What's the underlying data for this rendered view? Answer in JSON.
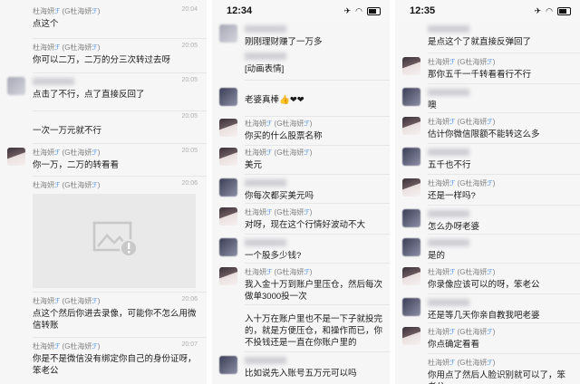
{
  "colors": {
    "panel_bg": "#f6f6f6",
    "nickname": "#808080",
    "timestamp": "#b0b0b0",
    "fish_icon": "#4a90e2"
  },
  "panel1": {
    "messages": [
      {
        "name": "杜海妍",
        "tag": "(G杜海妍",
        "time": "20:04",
        "text": "点这个"
      },
      {
        "name": "杜海妍",
        "tag": "(G杜海妍",
        "time": "20:05",
        "text": "你可以二万，二万的分三次转过去呀"
      },
      {
        "time": "20:05",
        "text": "点击了不行，点了直接反回了"
      },
      {
        "time": "20:05",
        "text": "一次一万元就不行"
      },
      {
        "name": "杜海妍",
        "tag": "(G杜海妍",
        "time": "20:05",
        "text": "你一万，二万的转看看"
      },
      {
        "name": "杜海妍",
        "tag": "(G杜海妍",
        "time": "20:06",
        "text": ""
      },
      {
        "name": "杜海妍",
        "tag": "(G杜海妍",
        "time": "20:06",
        "text": "点这个然后你进去录像，可能你不怎么用微信转账"
      },
      {
        "name": "杜海妍",
        "tag": "(G杜海妍",
        "time": "20:07",
        "text": "你是不是微信没有绑定你自己的身份证呀，笨老公"
      }
    ]
  },
  "panel2": {
    "status_time": "12:34",
    "messages": [
      {
        "text": "刚刚理财赚了一万多"
      },
      {
        "text": "[动画表情]"
      },
      {
        "text": "老婆真棒👍❤❤"
      },
      {
        "name": "杜海妍",
        "tag": "(G杜海妍",
        "text": "你买的什么股票名称"
      },
      {
        "name": "杜海妍",
        "tag": "(G杜海妍",
        "text": "美元"
      },
      {
        "text": "你每次都买美元吗"
      },
      {
        "name": "杜海妍",
        "tag": "(G杜海妍",
        "text": "对呀，现在这个行情好波动不大"
      },
      {
        "text": "一个股多少钱?"
      },
      {
        "name": "杜海妍",
        "tag": "(G杜海妍",
        "text": "我入金十万到账户里压仓，然后每次做单3000投一次"
      },
      {
        "text": "入十万在账户里也不是一下子就投完的，就是方便压仓，和操作而已，你不投钱还是一直在你账户里的"
      },
      {
        "text": "比如说先入账号五万元可以吗"
      }
    ]
  },
  "panel3": {
    "status_time": "12:35",
    "messages": [
      {
        "text": "是点这个了就直接反弹回了"
      },
      {
        "name": "杜海妍",
        "tag": "(G杜海妍",
        "text": "那你五千一千转看看行不行"
      },
      {
        "text": "噢"
      },
      {
        "name": "杜海妍",
        "tag": "(G杜海妍",
        "text": "估计你微信限额不能转这么多"
      },
      {
        "text": "五千也不行"
      },
      {
        "name": "杜海妍",
        "tag": "(G杜海妍",
        "text": "还是一样吗?"
      },
      {
        "text": "怎么办呀老婆"
      },
      {
        "text": "是的"
      },
      {
        "name": "杜海妍",
        "tag": "(G杜海妍",
        "text": "你录像应该可以的呀，笨老公"
      },
      {
        "text": "还是等几天你亲自教我吧老婆"
      },
      {
        "name": "杜海妍",
        "tag": "(G杜海妍",
        "text": "你点确定看看"
      },
      {
        "name": "杜海妍",
        "tag": "(G杜海妍",
        "text": "你用点了然后人脸识别就可以了，笨老公"
      }
    ]
  }
}
